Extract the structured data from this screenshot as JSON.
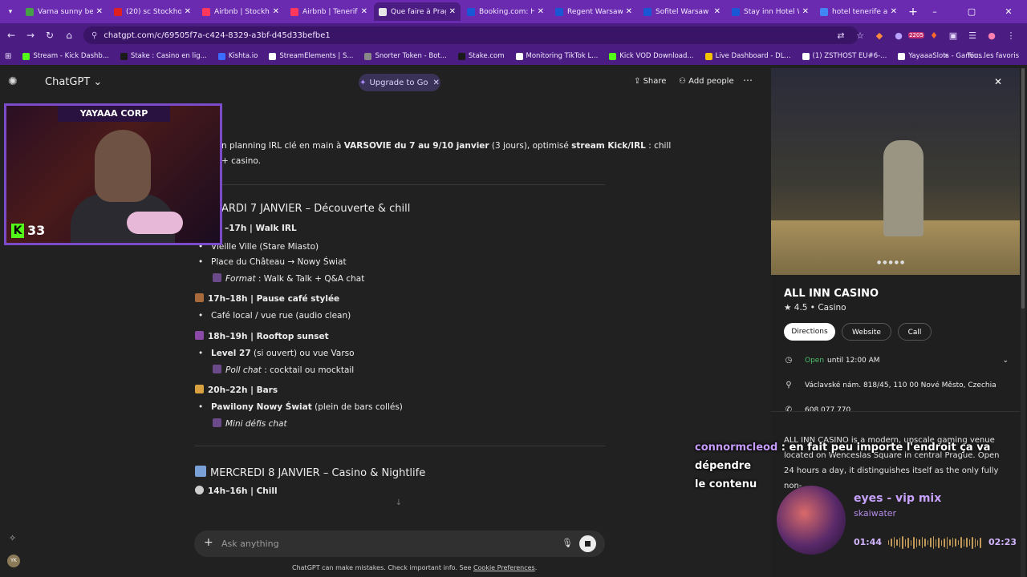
{
  "browser": {
    "tabs": [
      {
        "title": "Varna sunny beach",
        "color": "#46a046",
        "active": false
      },
      {
        "title": "(20) sc Stockholm",
        "color": "#e02020",
        "active": false
      },
      {
        "title": "Airbnb | Stockholm",
        "color": "#ff385c",
        "active": false
      },
      {
        "title": "Airbnb | Tenerife",
        "color": "#ff385c",
        "active": false
      },
      {
        "title": "Que faire à Prague",
        "color": "#e6e6e6",
        "active": true
      },
      {
        "title": "Booking.com: Hôt",
        "color": "#1a57d6",
        "active": false
      },
      {
        "title": "Regent Warsaw H",
        "color": "#1a57d6",
        "active": false
      },
      {
        "title": "Sofitel Warsaw Vi",
        "color": "#1a57d6",
        "active": false
      },
      {
        "title": "Stay inn Hotel W",
        "color": "#1a57d6",
        "active": false
      },
      {
        "title": "hotel tenerife all i",
        "color": "#4285f4",
        "active": false
      }
    ],
    "url": "chatgpt.com/c/69505f7a-c424-8329-a3bf-d45d33befbe1",
    "bookmarks": [
      "Stream - Kick Dashb...",
      "Stake : Casino en lig...",
      "Kishta.io",
      "StreamElements | S...",
      "Snorter Token - Bot...",
      "Stake.com",
      "Monitoring TikTok L...",
      "Kick VOD Download...",
      "Live Dashboard - DL...",
      "(1) ZSTHOST EU#6-...",
      "YayaaaSlots - Gamin..."
    ],
    "bookmarks_all": "Tous les favoris",
    "badge": "2205"
  },
  "chatgpt": {
    "title": "ChatGPT",
    "upgrade": "Upgrade to Go",
    "share": "Share",
    "add_people": "Add people",
    "avatar": "YK",
    "intro_line1_a": "n planning IRL clé en main à ",
    "intro_line1_b": "VARSOVIE du 7 au 9/10 janvier",
    "intro_line1_c": " (3 jours), optimisé ",
    "intro_line1_d": "stream Kick/IRL",
    "intro_line1_e": " : chill",
    "intro_line2": "+ casino.",
    "day1_title": "ARDI 7 JANVIER – Découverte & chill",
    "s1_title": "–17h | Walk IRL",
    "s1_b1": "Vieille Ville (Stare Miasto)",
    "s1_b2": "Place du Château → Nowy Świat",
    "s1_fmt_label": "Format",
    "s1_fmt_text": " : Walk & Talk + Q&A chat",
    "s2_title": "17h–18h | Pause café stylée",
    "s2_b1": "Café local / vue rue (audio clean)",
    "s3_title": "18h–19h | Rooftop sunset",
    "s3_b1_bold": "Level 27",
    "s3_b1_rest": " (si ouvert) ou vue Varso",
    "s3_poll_label": "Poll chat",
    "s3_poll_text": " : cocktail ou mocktail",
    "s4_title": "20h–22h | Bars",
    "s4_b1_bold": "Pawilony Nowy Świat",
    "s4_b1_rest": " (plein de bars collés)",
    "s4_sub": "Mini défis chat",
    "day2_title": "MERCREDI 8 JANVIER – Casino & Nightlife",
    "s5_title": "14h–16h | Chill",
    "composer_placeholder": "Ask anything",
    "disclaimer_text": "ChatGPT can make mistakes. Check important info. See ",
    "disclaimer_link": "Cookie Preferences",
    "disclaimer_end": "."
  },
  "webcam": {
    "label": "YAYAAA CORP",
    "viewers": "33"
  },
  "place": {
    "name": "ALL INN CASINO",
    "rating": "4.5",
    "category": "Casino",
    "btn_directions": "Directions",
    "btn_website": "Website",
    "btn_call": "Call",
    "open_status": "Open",
    "open_until": "until 12:00 AM",
    "address": "Václavské nám. 818/45, 110 00 Nové Město, Czechia",
    "phone": "608 077 770",
    "description": "ALL INN CASINO is a modern, upscale gaming venue located on Wenceslas Square in central Prague. Open 24 hours a day, it distinguishes itself as the only fully non-"
  },
  "overlay_chat": {
    "user": "connormcleod",
    "message_1": " : en fait peu importe l'endroit ça va dépendre",
    "message_2": "le contenu"
  },
  "music": {
    "title": "eyes - vip mix",
    "artist": "skaiwater",
    "position": "01:44",
    "duration": "02:23"
  }
}
